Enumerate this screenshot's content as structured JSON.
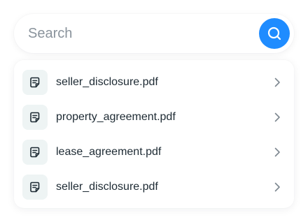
{
  "search": {
    "placeholder": "Search",
    "value": "",
    "button_icon": "search-icon",
    "accent_color": "#1f8cff"
  },
  "results": [
    {
      "name": "seller_disclosure.pdf",
      "icon": "document-icon"
    },
    {
      "name": "property_agreement.pdf",
      "icon": "document-icon"
    },
    {
      "name": "lease_agreement.pdf",
      "icon": "document-icon"
    },
    {
      "name": "seller_disclosure.pdf",
      "icon": "document-icon"
    }
  ]
}
